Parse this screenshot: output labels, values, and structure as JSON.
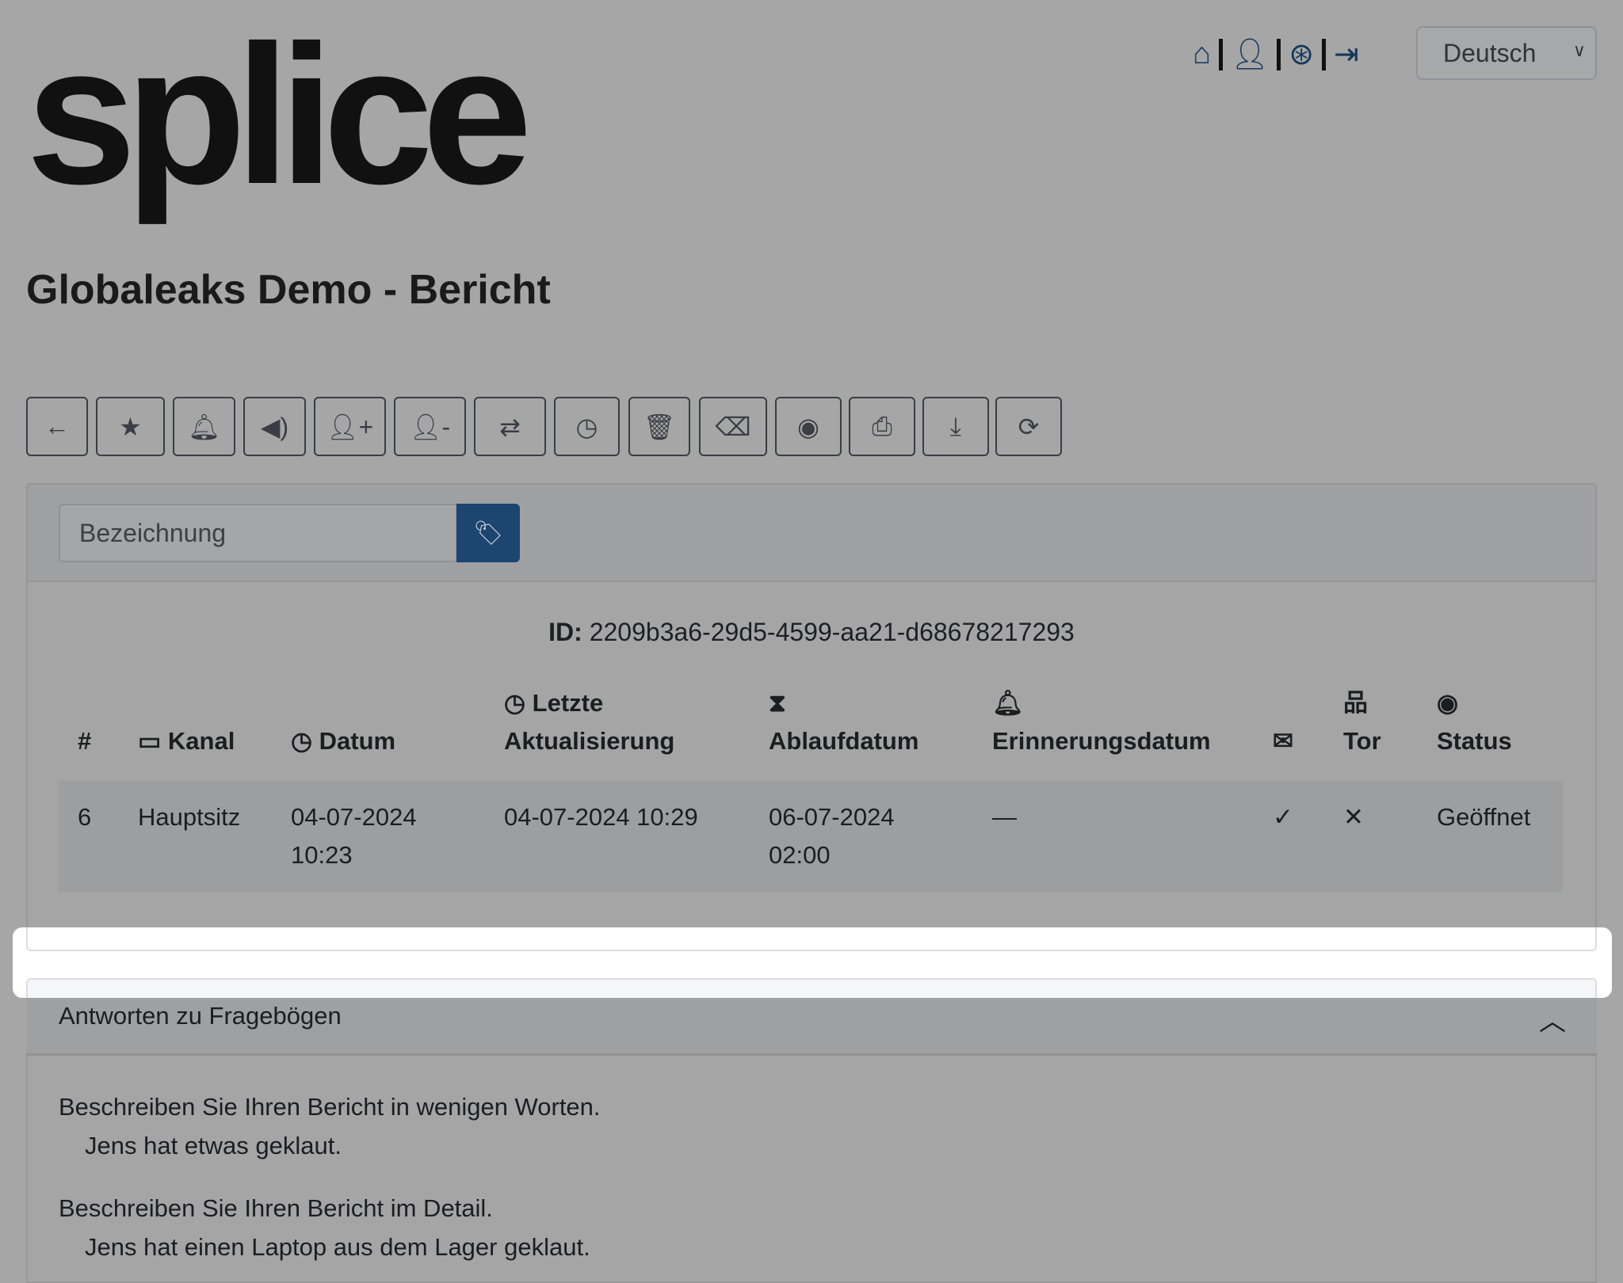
{
  "logo": "splice",
  "header": {
    "title": "Globaleaks Demo - Bericht",
    "icons": [
      "home-icon",
      "user-icon",
      "life-ring-icon",
      "sign-out-icon"
    ],
    "language": "Deutsch"
  },
  "toolbar": [
    "back-icon",
    "star-icon",
    "bell-icon",
    "bullhorn-icon",
    "user-plus-icon",
    "user-minus-icon",
    "people-arrows-icon",
    "clock-icon",
    "trash-icon",
    "eraser-icon",
    "circle-dot-icon",
    "print-icon",
    "download-icon",
    "refresh-icon"
  ],
  "label_input": {
    "placeholder": "Bezeichnung"
  },
  "report": {
    "id_label": "ID:",
    "id_value": "2209b3a6-29d5-4599-aa21-d68678217293"
  },
  "table": {
    "headers": {
      "num": "#",
      "channel": "Kanal",
      "date": "Datum",
      "last_update_1": "Letzte",
      "last_update_2": "Aktualisierung",
      "expiry": "Ablaufdatum",
      "reminder": "Erinnerungsdatum",
      "tor": "Tor",
      "status": "Status"
    },
    "row": {
      "num": "6",
      "channel": "Hauptsitz",
      "date_1": "04-07-2024",
      "date_2": "10:23",
      "last_update": "04-07-2024 10:29",
      "expiry_1": "06-07-2024",
      "expiry_2": "02:00",
      "reminder": "—",
      "notification": "✓",
      "tor": "✕",
      "status": "Geöffnet"
    }
  },
  "answers": {
    "title": "Antworten zu Fragebögen",
    "items": [
      {
        "q": "Beschreiben Sie Ihren Bericht in wenigen Worten.",
        "a": "Jens hat etwas geklaut."
      },
      {
        "q": "Beschreiben Sie Ihren Bericht im Detail.",
        "a": "Jens hat einen Laptop aus dem Lager geklaut."
      }
    ]
  },
  "colors": {
    "accent": "#1c4570",
    "icon_blue": "#14375c"
  }
}
